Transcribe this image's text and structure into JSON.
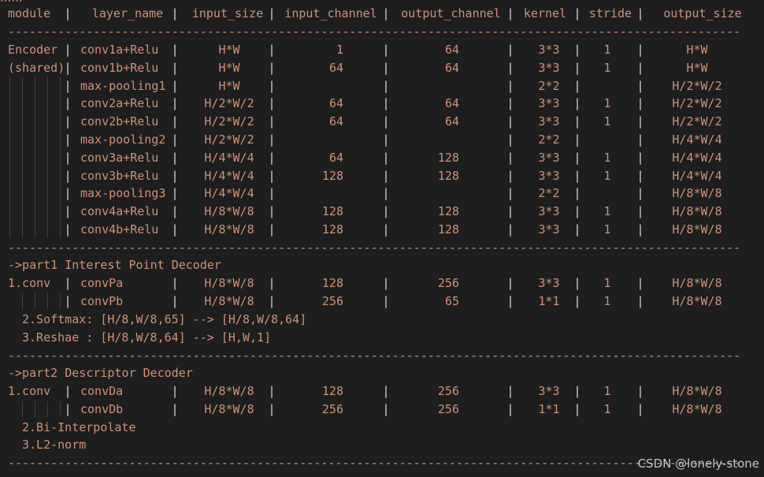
{
  "top_partial": "......",
  "header": [
    "module",
    "layer_name",
    "input_size",
    "input_channel",
    "output_channel",
    "kernel",
    "stride",
    "output_size"
  ],
  "encoder_rows": [
    {
      "module": "Encoder",
      "layer": "conv1a+Relu",
      "in_size": "H*W",
      "in_ch": "1",
      "out_ch": "64",
      "kernel": "3*3",
      "stride": "1",
      "out_size": "H*W"
    },
    {
      "module": "(shared)",
      "layer": "conv1b+Relu",
      "in_size": "H*W",
      "in_ch": "64",
      "out_ch": "64",
      "kernel": "3*3",
      "stride": "1",
      "out_size": "H*W"
    },
    {
      "module": "",
      "layer": "max-pooling1",
      "in_size": "H*W",
      "in_ch": "",
      "out_ch": "",
      "kernel": "2*2",
      "stride": "",
      "out_size": "H/2*W/2"
    },
    {
      "module": "",
      "layer": "conv2a+Relu",
      "in_size": "H/2*W/2",
      "in_ch": "64",
      "out_ch": "64",
      "kernel": "3*3",
      "stride": "1",
      "out_size": "H/2*W/2"
    },
    {
      "module": "",
      "layer": "conv2b+Relu",
      "in_size": "H/2*W/2",
      "in_ch": "64",
      "out_ch": "64",
      "kernel": "3*3",
      "stride": "1",
      "out_size": "H/2*W/2"
    },
    {
      "module": "",
      "layer": "max-pooling2",
      "in_size": "H/2*W/2",
      "in_ch": "",
      "out_ch": "",
      "kernel": "2*2",
      "stride": "",
      "out_size": "H/4*W/4"
    },
    {
      "module": "",
      "layer": "conv3a+Relu",
      "in_size": "H/4*W/4",
      "in_ch": "64",
      "out_ch": "128",
      "kernel": "3*3",
      "stride": "1",
      "out_size": "H/4*W/4"
    },
    {
      "module": "",
      "layer": "conv3b+Relu",
      "in_size": "H/4*W/4",
      "in_ch": "128",
      "out_ch": "128",
      "kernel": "3*3",
      "stride": "1",
      "out_size": "H/4*W/4"
    },
    {
      "module": "",
      "layer": "max-pooling3",
      "in_size": "H/4*W/4",
      "in_ch": "",
      "out_ch": "",
      "kernel": "2*2",
      "stride": "",
      "out_size": "H/8*W/8"
    },
    {
      "module": "",
      "layer": "conv4a+Relu",
      "in_size": "H/8*W/8",
      "in_ch": "128",
      "out_ch": "128",
      "kernel": "3*3",
      "stride": "1",
      "out_size": "H/8*W/8"
    },
    {
      "module": "",
      "layer": "conv4b+Relu",
      "in_size": "H/8*W/8",
      "in_ch": "128",
      "out_ch": "128",
      "kernel": "3*3",
      "stride": "1",
      "out_size": "H/8*W/8"
    }
  ],
  "part1": {
    "title": "->part1 Interest Point Decoder",
    "rows": [
      {
        "module": "1.conv",
        "layer": "convPa",
        "in_size": "H/8*W/8",
        "in_ch": "128",
        "out_ch": "256",
        "kernel": "3*3",
        "stride": "1",
        "out_size": "H/8*W/8"
      },
      {
        "module": "",
        "layer": "convPb",
        "in_size": "H/8*W/8",
        "in_ch": "256",
        "out_ch": "65",
        "kernel": "1*1",
        "stride": "1",
        "out_size": "H/8*W/8"
      }
    ],
    "notes": [
      "2.Softmax: [H/8,W/8,65] --> [H/8,W/8,64]",
      "3.Reshae : [H/8,W/8,64] --> [H,W,1]"
    ]
  },
  "part2": {
    "title": "->part2 Descriptor Decoder",
    "rows": [
      {
        "module": "1.conv",
        "layer": "convDa",
        "in_size": "H/8*W/8",
        "in_ch": "128",
        "out_ch": "256",
        "kernel": "3*3",
        "stride": "1",
        "out_size": "H/8*W/8"
      },
      {
        "module": "",
        "layer": "convDb",
        "in_size": "H/8*W/8",
        "in_ch": "256",
        "out_ch": "256",
        "kernel": "1*1",
        "stride": "1",
        "out_size": "H/8*W/8"
      }
    ],
    "notes": [
      "2.Bi-Interpolate",
      "3.L2-norm"
    ]
  },
  "watermark": "CSDN @lonely-stone"
}
